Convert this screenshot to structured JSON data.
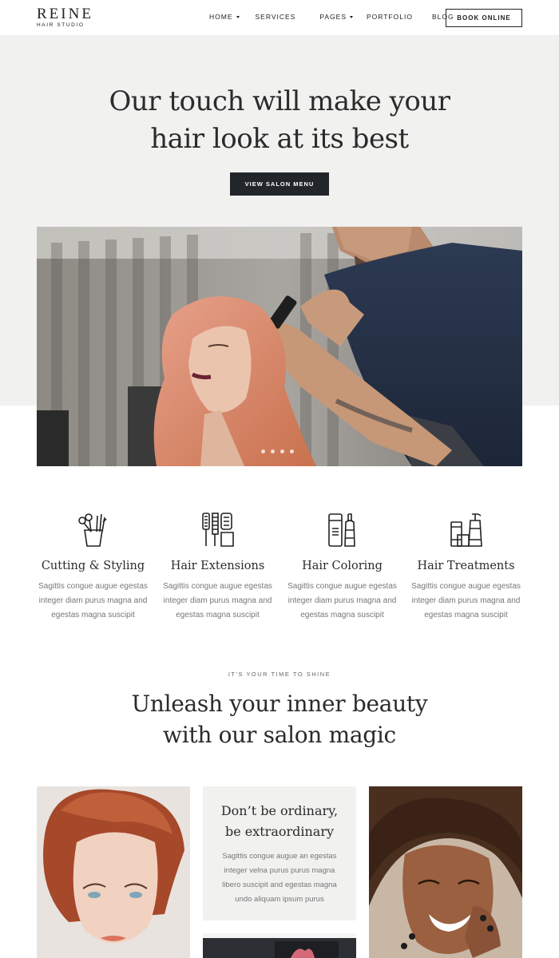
{
  "brand": {
    "name": "REINE",
    "tagline": "HAIR STUDIO"
  },
  "nav": {
    "items": [
      {
        "label": "HOME",
        "has_dropdown": true
      },
      {
        "label": "SERVICES",
        "has_dropdown": false
      },
      {
        "label": "PAGES",
        "has_dropdown": true
      },
      {
        "label": "PORTFOLIO",
        "has_dropdown": false
      },
      {
        "label": "BLOG",
        "has_dropdown": false
      }
    ],
    "cta": "BOOK ONLINE"
  },
  "hero": {
    "title_line1": "Our touch will make your",
    "title_line2": "hair look at its best",
    "button": "VIEW SALON MENU",
    "slider_dots": 4
  },
  "services": [
    {
      "title": "Cutting & Styling",
      "text": "Sagittis congue augue egestas integer diam purus magna and egestas magna suscipit",
      "icon": "scissors-comb-icon"
    },
    {
      "title": "Hair Extensions",
      "text": "Sagittis congue augue egestas integer diam purus magna and egestas magna suscipit",
      "icon": "brushes-icon"
    },
    {
      "title": "Hair Coloring",
      "text": "Sagittis congue augue egestas integer diam purus magna and egestas magna suscipit",
      "icon": "color-bottles-icon"
    },
    {
      "title": "Hair Treatments",
      "text": "Sagittis congue augue egestas integer diam purus magna and egestas magna suscipit",
      "icon": "treatment-bottles-icon"
    }
  ],
  "intro": {
    "eyebrow": "IT'S YOUR TIME TO SHINE",
    "title_line1": "Unleash your inner beauty",
    "title_line2": "with our salon magic"
  },
  "card": {
    "title_line1": "Don’t be ordinary,",
    "title_line2": "be extraordinary",
    "text": "Sagittis congue augue an egestas integer velna purus purus magna libero suscipit and egestas magna undo aliquam ipsum purus"
  },
  "colors": {
    "hero_bg": "#f1f1f0",
    "dark_button": "#22262b",
    "text": "#2b2b2b",
    "muted": "#777777"
  }
}
